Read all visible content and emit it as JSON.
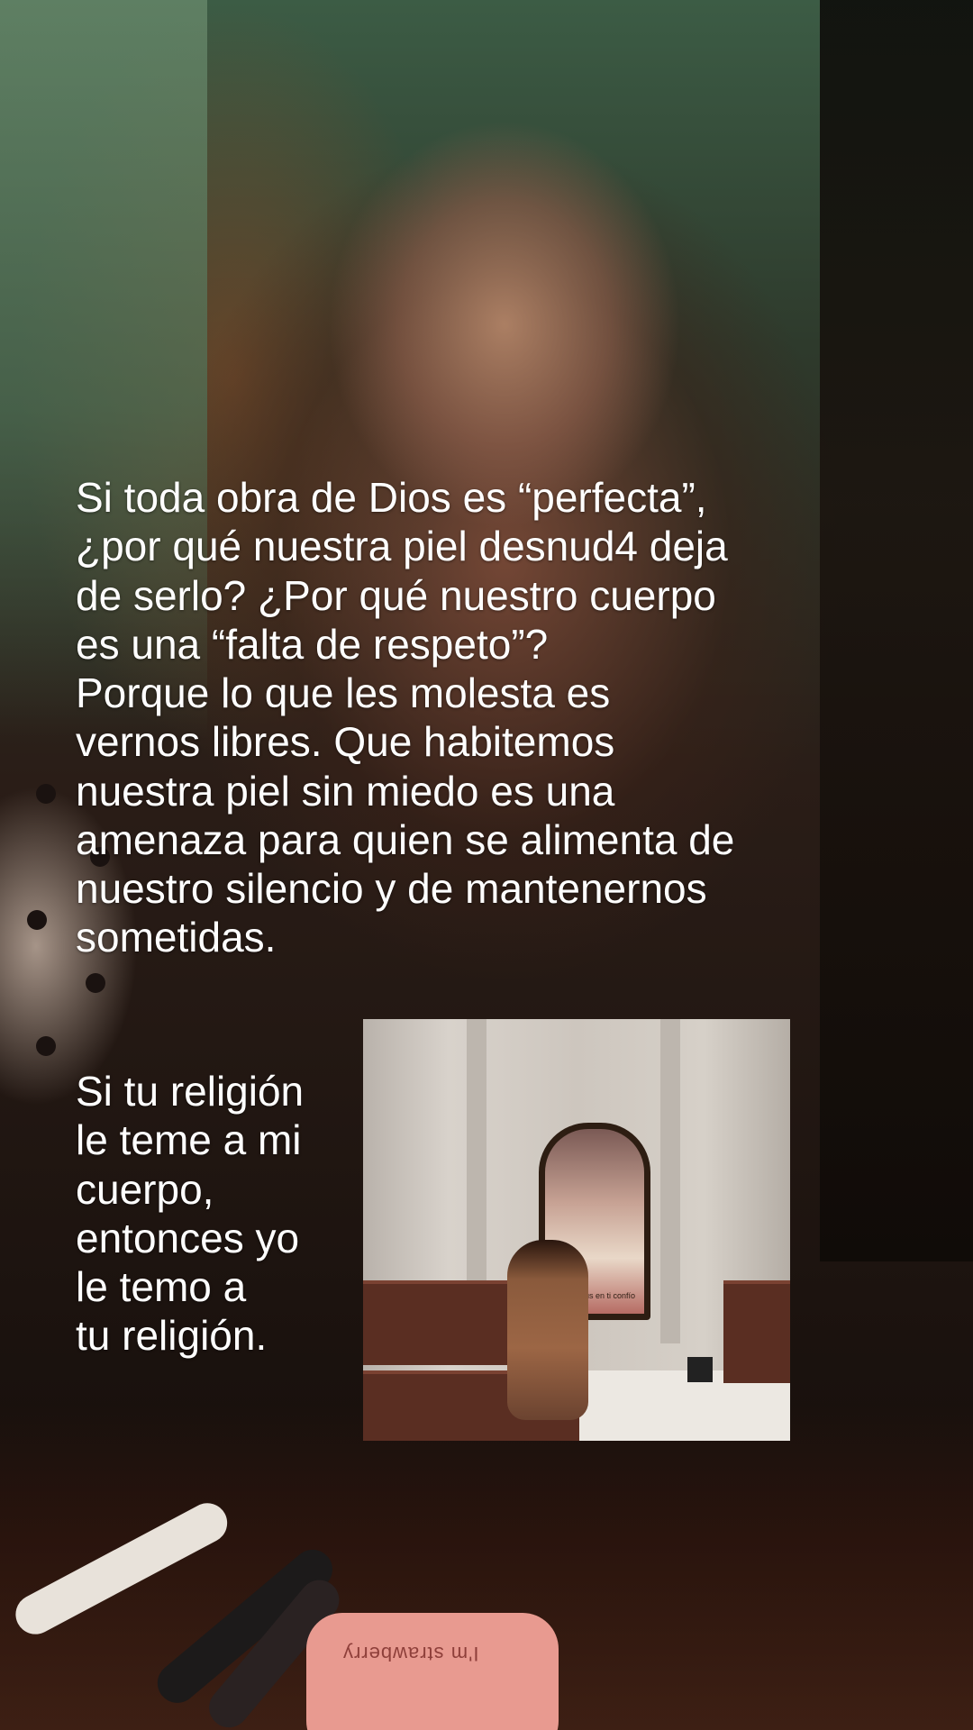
{
  "caption": {
    "main": "Si toda obra de Dios es “perfecta”,\n¿por qué nuestra piel desnud4 deja\nde serlo? ¿Por qué nuestro cuerpo\nes una “falta de respeto”?\nPorque lo que les molesta es\nvernos libres. Que habitemos\nnuestra piel sin miedo es una\namenaza para quien se alimenta de\nnuestro silencio y de mantenernos\nsometidas.",
    "lower": "Si tu religión\nle teme a mi\ncuerpo,\nentonces yo\nle temo a\ntu religión."
  },
  "photo": {
    "painting_label": "Jesús en ti confío"
  },
  "background": {
    "compact_text": "I'm strawberry"
  }
}
